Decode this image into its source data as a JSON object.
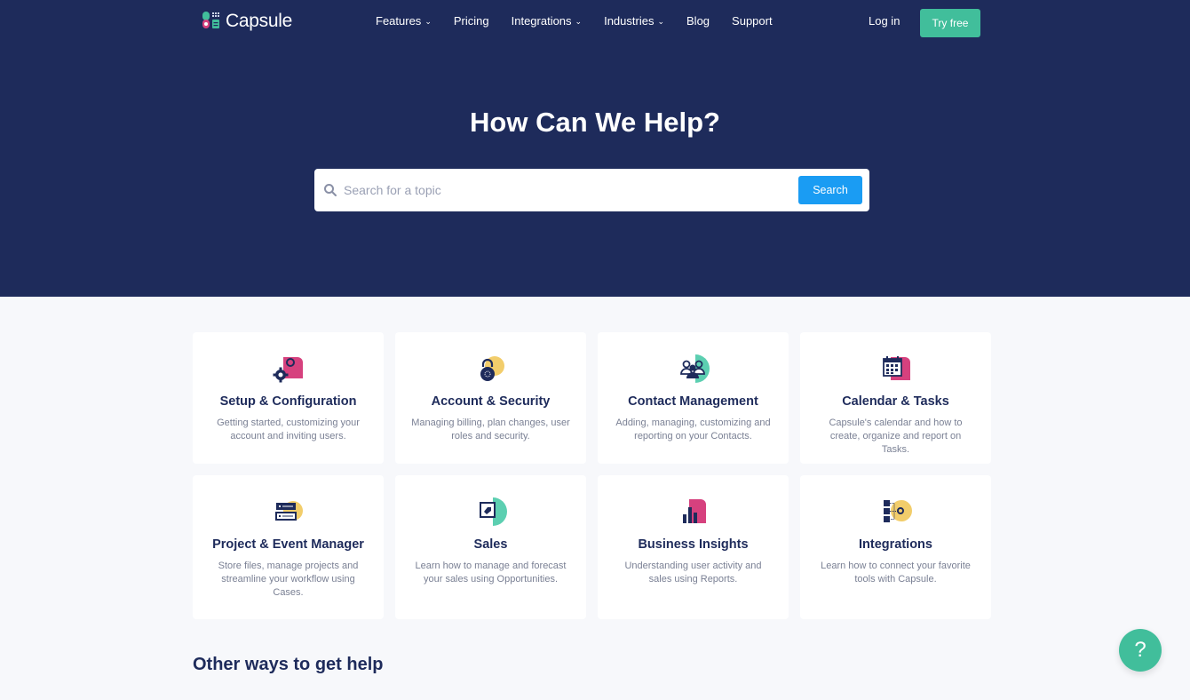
{
  "brand": {
    "name": "Capsule"
  },
  "nav": {
    "links": [
      {
        "label": "Features",
        "has_dropdown": true
      },
      {
        "label": "Pricing",
        "has_dropdown": false
      },
      {
        "label": "Integrations",
        "has_dropdown": true
      },
      {
        "label": "Industries",
        "has_dropdown": true
      },
      {
        "label": "Blog",
        "has_dropdown": false
      },
      {
        "label": "Support",
        "has_dropdown": false
      }
    ],
    "chevron": "⌄",
    "login_label": "Log in",
    "try_free_label": "Try free"
  },
  "hero": {
    "title": "How Can We Help?",
    "search": {
      "placeholder": "Search for a topic",
      "value": "",
      "button_label": "Search"
    }
  },
  "categories": [
    {
      "icon": "gears-icon",
      "title": "Setup & Configuration",
      "description": "Getting started, customizing your account and inviting users."
    },
    {
      "icon": "padlock-icon",
      "title": "Account & Security",
      "description": "Managing billing, plan changes, user roles and security."
    },
    {
      "icon": "people-icon",
      "title": "Contact Management",
      "description": "Adding, managing, customizing and reporting on your Contacts."
    },
    {
      "icon": "calendar-icon",
      "title": "Calendar & Tasks",
      "description": "Capsule's calendar and how to create, organize and report on Tasks."
    },
    {
      "icon": "folders-icon",
      "title": "Project & Event Manager",
      "description": "Store files, manage projects and streamline your workflow using Cases."
    },
    {
      "icon": "tag-icon",
      "title": "Sales",
      "description": "Learn how to manage and forecast your sales using Opportunities."
    },
    {
      "icon": "bar-chart-icon",
      "title": "Business Insights",
      "description": "Understanding user activity and sales using Reports."
    },
    {
      "icon": "connections-icon",
      "title": "Integrations",
      "description": "Learn how to connect your favorite tools with Capsule."
    }
  ],
  "other_help": {
    "heading": "Other ways to get help"
  },
  "help_fab": {
    "label": "?"
  },
  "colors": {
    "navy": "#1e2b5b",
    "green": "#41be9b",
    "blue": "#1a9cf3",
    "pink": "#d6417e",
    "yellow": "#f2cd6b",
    "teal": "#5ccfb1"
  }
}
